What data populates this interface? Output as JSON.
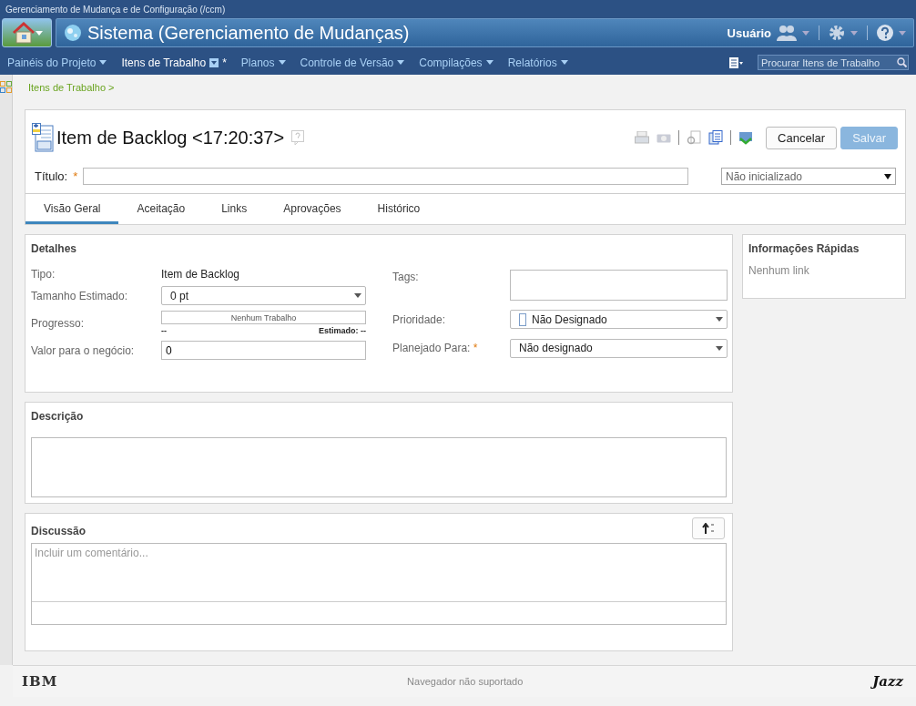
{
  "window": {
    "title": "Gerenciamento de Mudança e de Configuração (/ccm)"
  },
  "banner": {
    "title": "Sistema (Gerenciamento de Mudanças)",
    "user": "Usuário"
  },
  "nav": {
    "items": [
      {
        "label": "Painéis do Projeto",
        "selected": false
      },
      {
        "label": "Itens de Trabalho",
        "selected": true,
        "marker": "*"
      },
      {
        "label": "Planos",
        "selected": false
      },
      {
        "label": "Controle de Versão",
        "selected": false
      },
      {
        "label": "Compilações",
        "selected": false
      },
      {
        "label": "Relatórios",
        "selected": false
      }
    ],
    "search": {
      "placeholder": "Procurar Itens de Trabalho"
    }
  },
  "breadcrumb": "Itens de Trabalho >",
  "work_item": {
    "title": "Item de Backlog <17:20:37>",
    "title_label": "Título:",
    "required_mark": "*",
    "state": "Não inicializado",
    "buttons": [
      {
        "label": "Cancelar",
        "disabled": false
      },
      {
        "label": "Salvar",
        "disabled": true
      }
    ]
  },
  "tabs": [
    {
      "label": "Visão Geral",
      "selected": true
    },
    {
      "label": "Aceitação",
      "selected": false
    },
    {
      "label": "Links",
      "selected": false
    },
    {
      "label": "Aprovações",
      "selected": false
    },
    {
      "label": "Histórico",
      "selected": false
    }
  ],
  "details": {
    "heading": "Detalhes",
    "left": [
      {
        "kind": "text",
        "label": "Tipo:",
        "value": "Item de Backlog"
      },
      {
        "kind": "select",
        "label": "Tamanho Estimado:",
        "value": "0 pt"
      },
      {
        "kind": "progress",
        "label": "Progresso:",
        "bar_text": "Nenhum Trabalho",
        "left_note": "--",
        "right_note": "Estimado: --"
      },
      {
        "kind": "input",
        "label": "Valor para o negócio:",
        "value": "0"
      }
    ],
    "right": [
      {
        "kind": "textarea",
        "label": "Tags:"
      },
      {
        "kind": "priority",
        "label": "Prioridade:",
        "value": "Não Designado"
      },
      {
        "kind": "select",
        "label": "Planejado Para:",
        "value": "Não designado",
        "required_mark": "*"
      }
    ]
  },
  "quick_info": {
    "heading": "Informações Rápidas",
    "text": "Nenhum link"
  },
  "description": {
    "heading": "Descrição"
  },
  "discussion": {
    "heading": "Discussão",
    "placeholder": "Incluir um comentário..."
  },
  "footer": {
    "logo_left": "IBM",
    "message": "Navegador não suportado",
    "logo_right": "Jazz"
  }
}
